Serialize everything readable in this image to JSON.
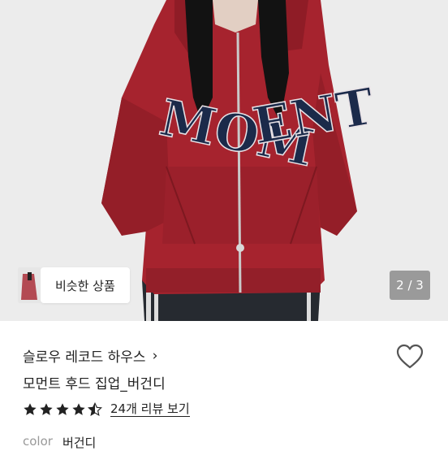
{
  "gallery": {
    "similar_label": "비슷한 상품",
    "page_indicator": "2 / 3",
    "print_text_left": "MOM",
    "print_text_right": "ENT"
  },
  "product": {
    "store_name": "슬로우 레코드 하우스",
    "store_chevron": "›",
    "title": "모먼트 후드 집업_버건디",
    "rating": 4.5,
    "review_link": "24개 리뷰 보기",
    "option_label": "color",
    "option_value": "버건디"
  },
  "colors": {
    "hoodie": "#a6232e",
    "lettering": "#1b2a4a"
  }
}
